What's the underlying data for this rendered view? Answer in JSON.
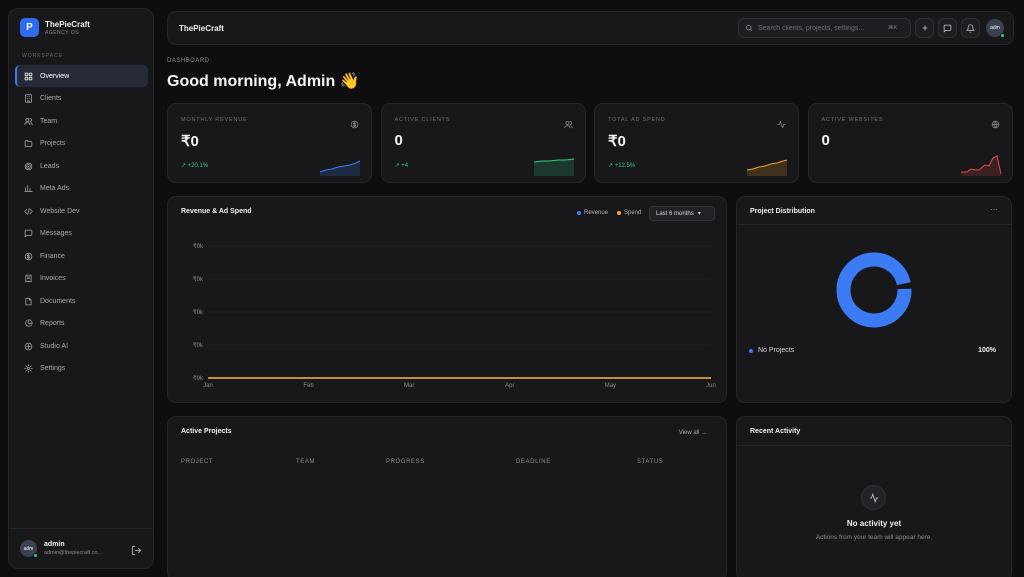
{
  "brand": {
    "name": "ThePieCraft",
    "sub": "AGENCY OS",
    "logo_letter": "P",
    "color": "#2f6bf0"
  },
  "sidebar": {
    "section_label": "WORKSPACE",
    "items": [
      {
        "label": "Overview",
        "icon": "grid-icon",
        "active": true
      },
      {
        "label": "Clients",
        "icon": "building-icon"
      },
      {
        "label": "Team",
        "icon": "users-icon"
      },
      {
        "label": "Projects",
        "icon": "folder-icon"
      },
      {
        "label": "Leads",
        "icon": "target-icon"
      },
      {
        "label": "Meta Ads",
        "icon": "bar-chart-icon"
      },
      {
        "label": "Website Dev",
        "icon": "code-icon"
      },
      {
        "label": "Messages",
        "icon": "message-icon"
      },
      {
        "label": "Finance",
        "icon": "dollar-icon"
      },
      {
        "label": "Invoices",
        "icon": "receipt-icon"
      },
      {
        "label": "Documents",
        "icon": "document-icon"
      },
      {
        "label": "Reports",
        "icon": "pie-chart-icon"
      },
      {
        "label": "Studio AI",
        "icon": "sparkle-icon"
      },
      {
        "label": "Settings",
        "icon": "gear-icon"
      }
    ],
    "user": {
      "name": "admin",
      "email": "admin@thepiecraft.co...",
      "avatar_text": "adm"
    }
  },
  "topbar": {
    "title": "ThePieCraft",
    "search_placeholder": "Search clients, projects, settings...",
    "search_kbd": "⌘K",
    "avatar_text": "adm"
  },
  "breadcrumb": "DASHBOARD",
  "greeting": "Good morning, Admin",
  "greeting_emoji": "👋",
  "stats": [
    {
      "label": "MONTHLY REVENUE",
      "value": "₹0",
      "delta": "↗ +20.1%",
      "icon": "dollar-icon",
      "color": "#3b7cf5"
    },
    {
      "label": "ACTIVE CLIENTS",
      "value": "0",
      "delta": "↗ +4",
      "icon": "users-icon",
      "color": "#2bd17e"
    },
    {
      "label": "TOTAL AD SPEND",
      "value": "₹0",
      "delta": "↗ +12.5%",
      "icon": "activity-icon",
      "color": "#f5a524"
    },
    {
      "label": "ACTIVE WEBSITES",
      "value": "0",
      "delta": "",
      "icon": "globe-icon",
      "color": "#e5484d"
    }
  ],
  "revenue_chart": {
    "title": "Revenue & Ad Spend",
    "legend_revenue": "Revenue",
    "legend_spend": "Spend",
    "range": "Last 6 months",
    "colors": {
      "revenue": "#3b7cf5",
      "spend": "#f5a524"
    }
  },
  "chart_data": {
    "type": "line",
    "categories": [
      "Jan",
      "Feb",
      "Mar",
      "Apr",
      "May",
      "Jun"
    ],
    "yticks": [
      "₹0k",
      "₹0k",
      "₹0k",
      "₹0k",
      "₹0k"
    ],
    "series": [
      {
        "name": "Revenue",
        "values": [
          0,
          0,
          0,
          0,
          0,
          0
        ],
        "color": "#3b7cf5"
      },
      {
        "name": "Spend",
        "values": [
          0,
          0,
          0,
          0,
          0,
          0
        ],
        "color": "#f5a524"
      }
    ],
    "title": "Revenue & Ad Spend",
    "xlabel": "",
    "ylabel": "",
    "ylim": [
      0,
      4
    ],
    "grid": true,
    "legend": "top-right"
  },
  "distribution": {
    "title": "Project Distribution",
    "more_icon": "···",
    "legend_label": "No Projects",
    "legend_pct": "100%",
    "value": 100,
    "color": "#3b7cf5"
  },
  "active_projects": {
    "title": "Active Projects",
    "view_all": "View all",
    "columns": [
      "PROJECT",
      "TEAM",
      "PROGRESS",
      "DEADLINE",
      "STATUS"
    ]
  },
  "recent_activity": {
    "title": "Recent Activity",
    "empty_title": "No activity yet",
    "empty_sub": "Actions from your team will appear here."
  }
}
